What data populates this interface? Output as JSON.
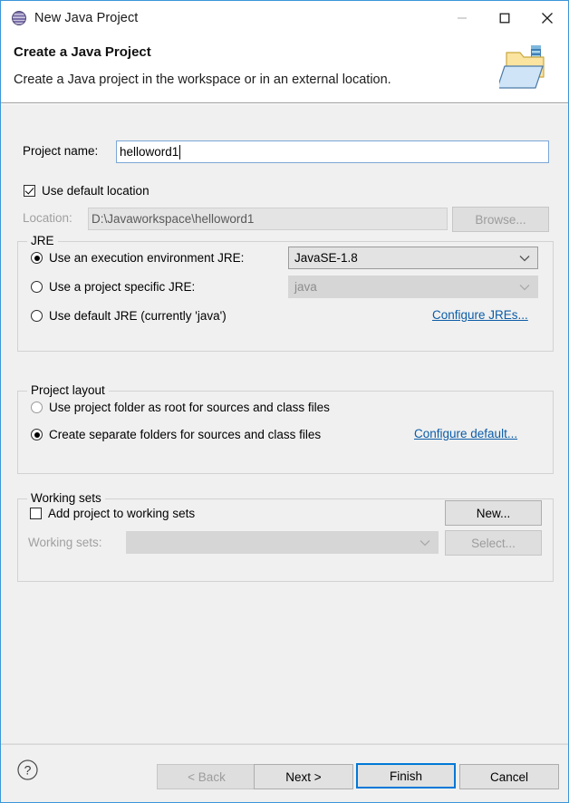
{
  "window": {
    "title": "New Java Project",
    "app_icon": "eclipse-sphere-icon",
    "controls": {
      "minimize": "minimize-icon",
      "maximize": "maximize-icon",
      "close": "close-icon"
    }
  },
  "header": {
    "title": "Create a Java Project",
    "subtitle": "Create a Java project in the workspace or in an external location.",
    "banner_icon": "new-java-project-folder-icon"
  },
  "project": {
    "name_label": "Project name:",
    "name_value": "helloword1",
    "use_default_location_label": "Use default location",
    "use_default_location_checked": true,
    "location_label": "Location:",
    "location_value": "D:\\Javaworkspace\\helloword1",
    "browse_label": "Browse...",
    "browse_enabled": false
  },
  "jre": {
    "group_title": "JRE",
    "options": [
      {
        "id": "execution-environment",
        "label": "Use an execution environment JRE:",
        "selected": true,
        "combo_value": "JavaSE-1.8",
        "combo_enabled": true
      },
      {
        "id": "project-specific",
        "label": "Use a project specific JRE:",
        "selected": false,
        "combo_value": "java",
        "combo_enabled": false
      },
      {
        "id": "default-jre",
        "label": "Use default JRE (currently 'java')",
        "selected": false
      }
    ],
    "configure_link": "Configure JREs..."
  },
  "layout": {
    "group_title": "Project layout",
    "options": [
      {
        "id": "project-folder-root",
        "label": "Use project folder as root for sources and class files",
        "selected": false
      },
      {
        "id": "separate-folders",
        "label": "Create separate folders for sources and class files",
        "selected": true
      }
    ],
    "configure_link": "Configure default..."
  },
  "working_sets": {
    "group_title": "Working sets",
    "add_label": "Add project to working sets",
    "add_checked": false,
    "new_label": "New...",
    "sets_label": "Working sets:",
    "sets_value": "",
    "select_label": "Select...",
    "select_enabled": false
  },
  "footer": {
    "help_icon": "help-question-icon",
    "back_label": "< Back",
    "back_enabled": false,
    "next_label": "Next >",
    "finish_label": "Finish",
    "cancel_label": "Cancel"
  },
  "colors": {
    "dialog_border": "#3b96d9",
    "accent": "#0078d7",
    "link": "#0b5ca8",
    "body_bg": "#f0f0f0"
  }
}
